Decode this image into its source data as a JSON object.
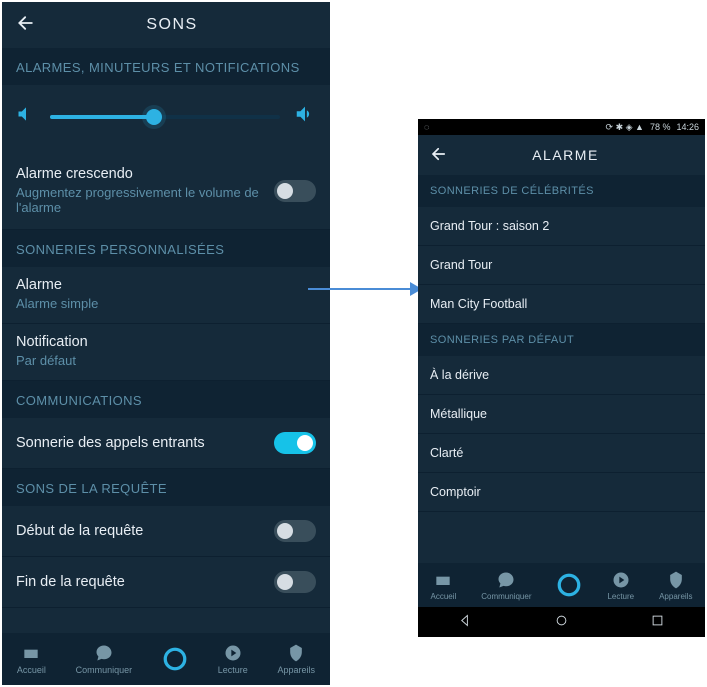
{
  "left": {
    "title": "SONS",
    "sec_alarms": "ALARMES, MINUTEURS ET NOTIFICATIONS",
    "slider_value": 45,
    "crescendo": {
      "label": "Alarme crescendo",
      "desc": "Augmentez progressivement le volume de l'alarme",
      "on": false
    },
    "sec_custom": "SONNERIES PERSONNALISÉES",
    "alarm": {
      "label": "Alarme",
      "value": "Alarme simple"
    },
    "notification": {
      "label": "Notification",
      "value": "Par défaut"
    },
    "sec_comm": "COMMUNICATIONS",
    "incoming": {
      "label": "Sonnerie des appels entrants",
      "on": true
    },
    "sec_request": "SONS DE LA REQUÊTE",
    "req_start": {
      "label": "Début de la requête",
      "on": false
    },
    "req_end": {
      "label": "Fin de la requête",
      "on": false
    },
    "nav": [
      "Accueil",
      "Communiquer",
      "",
      "Lecture",
      "Appareils"
    ]
  },
  "right": {
    "status_time": "14:26",
    "status_batt": "78 %",
    "title": "ALARME",
    "sec_celeb": "SONNERIES DE CÉLÉBRITÉS",
    "celeb": [
      "Grand Tour : saison 2",
      "Grand Tour",
      "Man City Football"
    ],
    "sec_default": "SONNERIES PAR DÉFAUT",
    "def": [
      "À la dérive",
      "Métallique",
      "Clarté",
      "Comptoir"
    ],
    "nav": [
      "Accueil",
      "Communiquer",
      "",
      "Lecture",
      "Appareils"
    ]
  }
}
